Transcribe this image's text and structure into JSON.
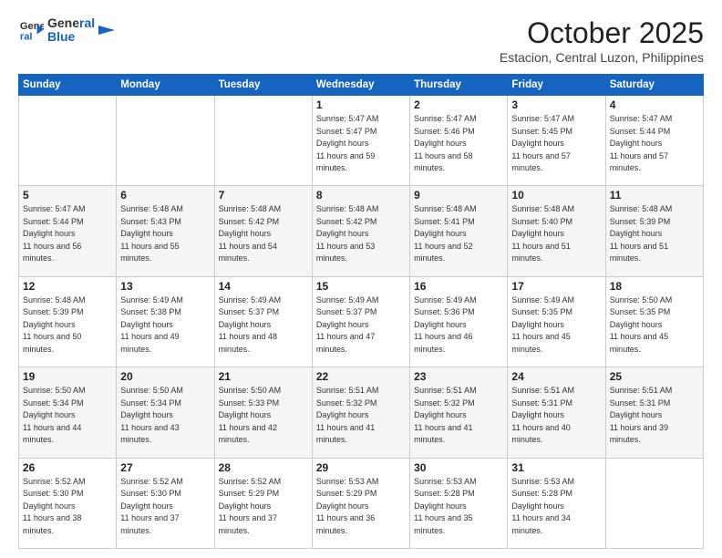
{
  "header": {
    "logo_line1": "General",
    "logo_line2": "Blue",
    "month": "October 2025",
    "location": "Estacion, Central Luzon, Philippines"
  },
  "weekdays": [
    "Sunday",
    "Monday",
    "Tuesday",
    "Wednesday",
    "Thursday",
    "Friday",
    "Saturday"
  ],
  "weeks": [
    [
      {
        "day": "",
        "sunrise": "",
        "sunset": "",
        "daylight": ""
      },
      {
        "day": "",
        "sunrise": "",
        "sunset": "",
        "daylight": ""
      },
      {
        "day": "",
        "sunrise": "",
        "sunset": "",
        "daylight": ""
      },
      {
        "day": "1",
        "sunrise": "5:47 AM",
        "sunset": "5:47 PM",
        "daylight": "11 hours and 59 minutes."
      },
      {
        "day": "2",
        "sunrise": "5:47 AM",
        "sunset": "5:46 PM",
        "daylight": "11 hours and 58 minutes."
      },
      {
        "day": "3",
        "sunrise": "5:47 AM",
        "sunset": "5:45 PM",
        "daylight": "11 hours and 57 minutes."
      },
      {
        "day": "4",
        "sunrise": "5:47 AM",
        "sunset": "5:44 PM",
        "daylight": "11 hours and 57 minutes."
      }
    ],
    [
      {
        "day": "5",
        "sunrise": "5:47 AM",
        "sunset": "5:44 PM",
        "daylight": "11 hours and 56 minutes."
      },
      {
        "day": "6",
        "sunrise": "5:48 AM",
        "sunset": "5:43 PM",
        "daylight": "11 hours and 55 minutes."
      },
      {
        "day": "7",
        "sunrise": "5:48 AM",
        "sunset": "5:42 PM",
        "daylight": "11 hours and 54 minutes."
      },
      {
        "day": "8",
        "sunrise": "5:48 AM",
        "sunset": "5:42 PM",
        "daylight": "11 hours and 53 minutes."
      },
      {
        "day": "9",
        "sunrise": "5:48 AM",
        "sunset": "5:41 PM",
        "daylight": "11 hours and 52 minutes."
      },
      {
        "day": "10",
        "sunrise": "5:48 AM",
        "sunset": "5:40 PM",
        "daylight": "11 hours and 51 minutes."
      },
      {
        "day": "11",
        "sunrise": "5:48 AM",
        "sunset": "5:39 PM",
        "daylight": "11 hours and 51 minutes."
      }
    ],
    [
      {
        "day": "12",
        "sunrise": "5:48 AM",
        "sunset": "5:39 PM",
        "daylight": "11 hours and 50 minutes."
      },
      {
        "day": "13",
        "sunrise": "5:49 AM",
        "sunset": "5:38 PM",
        "daylight": "11 hours and 49 minutes."
      },
      {
        "day": "14",
        "sunrise": "5:49 AM",
        "sunset": "5:37 PM",
        "daylight": "11 hours and 48 minutes."
      },
      {
        "day": "15",
        "sunrise": "5:49 AM",
        "sunset": "5:37 PM",
        "daylight": "11 hours and 47 minutes."
      },
      {
        "day": "16",
        "sunrise": "5:49 AM",
        "sunset": "5:36 PM",
        "daylight": "11 hours and 46 minutes."
      },
      {
        "day": "17",
        "sunrise": "5:49 AM",
        "sunset": "5:35 PM",
        "daylight": "11 hours and 45 minutes."
      },
      {
        "day": "18",
        "sunrise": "5:50 AM",
        "sunset": "5:35 PM",
        "daylight": "11 hours and 45 minutes."
      }
    ],
    [
      {
        "day": "19",
        "sunrise": "5:50 AM",
        "sunset": "5:34 PM",
        "daylight": "11 hours and 44 minutes."
      },
      {
        "day": "20",
        "sunrise": "5:50 AM",
        "sunset": "5:34 PM",
        "daylight": "11 hours and 43 minutes."
      },
      {
        "day": "21",
        "sunrise": "5:50 AM",
        "sunset": "5:33 PM",
        "daylight": "11 hours and 42 minutes."
      },
      {
        "day": "22",
        "sunrise": "5:51 AM",
        "sunset": "5:32 PM",
        "daylight": "11 hours and 41 minutes."
      },
      {
        "day": "23",
        "sunrise": "5:51 AM",
        "sunset": "5:32 PM",
        "daylight": "11 hours and 41 minutes."
      },
      {
        "day": "24",
        "sunrise": "5:51 AM",
        "sunset": "5:31 PM",
        "daylight": "11 hours and 40 minutes."
      },
      {
        "day": "25",
        "sunrise": "5:51 AM",
        "sunset": "5:31 PM",
        "daylight": "11 hours and 39 minutes."
      }
    ],
    [
      {
        "day": "26",
        "sunrise": "5:52 AM",
        "sunset": "5:30 PM",
        "daylight": "11 hours and 38 minutes."
      },
      {
        "day": "27",
        "sunrise": "5:52 AM",
        "sunset": "5:30 PM",
        "daylight": "11 hours and 37 minutes."
      },
      {
        "day": "28",
        "sunrise": "5:52 AM",
        "sunset": "5:29 PM",
        "daylight": "11 hours and 37 minutes."
      },
      {
        "day": "29",
        "sunrise": "5:53 AM",
        "sunset": "5:29 PM",
        "daylight": "11 hours and 36 minutes."
      },
      {
        "day": "30",
        "sunrise": "5:53 AM",
        "sunset": "5:28 PM",
        "daylight": "11 hours and 35 minutes."
      },
      {
        "day": "31",
        "sunrise": "5:53 AM",
        "sunset": "5:28 PM",
        "daylight": "11 hours and 34 minutes."
      },
      {
        "day": "",
        "sunrise": "",
        "sunset": "",
        "daylight": ""
      }
    ]
  ]
}
